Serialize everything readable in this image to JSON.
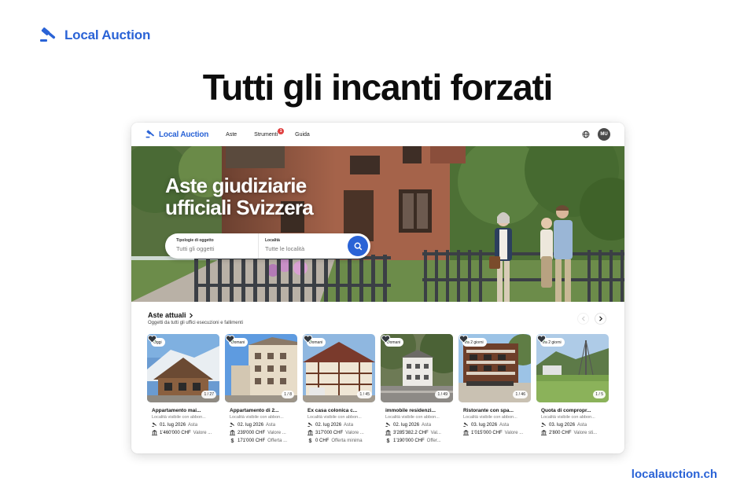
{
  "page": {
    "brand": "Local Auction",
    "headline": "Tutti gli incanti forzati",
    "footer_url": "localauction.ch"
  },
  "app": {
    "nav": {
      "logo": "Local Auction",
      "links": [
        "Aste",
        "Strumenti",
        "Guida"
      ],
      "notification_count": "1",
      "avatar_initials": "MU"
    },
    "hero": {
      "headline": "Aste giudiziarie ufficiali Svizzera",
      "search": {
        "type_label": "Tipologie di oggetto",
        "type_value": "Tutti gli oggetti",
        "location_label": "Località",
        "location_value": "Tutte le località"
      }
    },
    "section": {
      "title": "Aste attuali",
      "subtitle": "Oggetti da tutti gli uffici esecuzioni e fallimenti"
    },
    "cards": [
      {
        "badge": "Oggi",
        "count": "1 / 27",
        "title": "Appartamento mai...",
        "location": "Località visibile con abbon...",
        "date": "01. lug 2026",
        "date_label": "Asta",
        "price": "1'460'000 CHF",
        "price_label": "Valore ...",
        "offer": "",
        "offer_label": ""
      },
      {
        "badge": "Domani",
        "count": "1 / 8",
        "title": "Appartamento di 2...",
        "location": "Località visibile con abbon...",
        "date": "02. lug 2026",
        "date_label": "Asta",
        "price": "239'000 CHF",
        "price_label": "Valore ...",
        "offer": "171'000 CHF",
        "offer_label": "Offerta ..."
      },
      {
        "badge": "Domani",
        "count": "1 / 45",
        "title": "Ex casa colonica c...",
        "location": "Località visibile con abbon...",
        "date": "02. lug 2026",
        "date_label": "Asta",
        "price": "317'000 CHF",
        "price_label": "Valore ...",
        "offer": "0 CHF",
        "offer_label": "Offerta minima"
      },
      {
        "badge": "Domani",
        "count": "1 / 49",
        "title": "immobile residenzi...",
        "location": "Località visibile con abbon...",
        "date": "02. lug 2026",
        "date_label": "Asta",
        "price": "3'285'382.2 CHF",
        "price_label": "Val...",
        "offer": "1'190'000 CHF",
        "offer_label": "Offer..."
      },
      {
        "badge": "tra 2 giorni",
        "count": "1 / 46",
        "title": "Ristorante con spa...",
        "location": "Località visibile con abbon...",
        "date": "03. lug 2026",
        "date_label": "Asta",
        "price": "1'015'000 CHF",
        "price_label": "Valore ...",
        "offer": "",
        "offer_label": ""
      },
      {
        "badge": "tra 2 giorni",
        "count": "1 / 5",
        "title": "Quota di compropr...",
        "location": "Località visibile con abbon...",
        "date": "03. lug 2026",
        "date_label": "Asta",
        "price": "2'800 CHF",
        "price_label": "Valore sti...",
        "offer": "",
        "offer_label": ""
      }
    ]
  },
  "colors": {
    "brand_blue": "#2a63d6",
    "badge_green": "#3d9a45",
    "notification_red": "#e04040"
  },
  "icons": {
    "brand": "gavel-icon",
    "globe": "globe-icon",
    "search": "search-icon",
    "favorite": "heart-icon",
    "date": "gavel-icon",
    "price": "bank-icon",
    "offer": "dollar-icon",
    "next": "chevron-right-icon",
    "prev": "chevron-left-icon"
  }
}
